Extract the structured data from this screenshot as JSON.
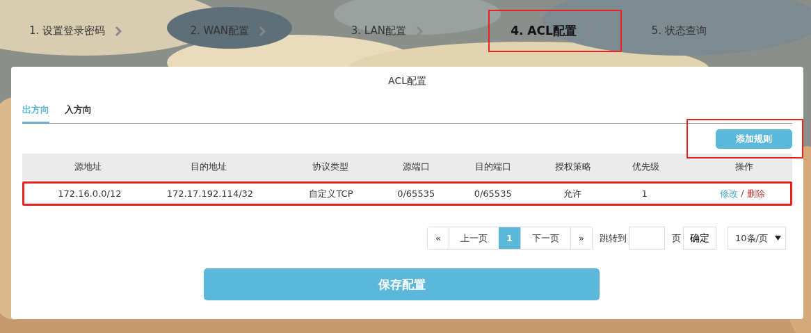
{
  "steps": [
    {
      "label": "1. 设置登录密码",
      "selected": false,
      "highlighted": false
    },
    {
      "label": "2. WAN配置",
      "selected": false,
      "highlighted": false
    },
    {
      "label": "3. LAN配置",
      "selected": false,
      "highlighted": false
    },
    {
      "label": "4. ACL配置",
      "selected": true,
      "highlighted": true
    },
    {
      "label": "5. 状态查询",
      "selected": false,
      "highlighted": false
    }
  ],
  "panel": {
    "title": "ACL配置",
    "tabs": [
      {
        "label": "出方向",
        "selected": true
      },
      {
        "label": "入方向",
        "selected": false
      }
    ],
    "add_button": {
      "label": "添加规则",
      "highlighted": true
    },
    "table": {
      "columns": [
        "源地址",
        "目的地址",
        "协议类型",
        "源端口",
        "目的端口",
        "授权策略",
        "优先级",
        "操作"
      ],
      "rows": [
        {
          "highlighted": true,
          "cells": [
            "172.16.0.0/12",
            "172.17.192.114/32",
            "自定义TCP",
            "0/65535",
            "0/65535",
            "允许",
            "1"
          ],
          "edit": "修改",
          "separator": "/",
          "delete": "删除"
        }
      ]
    },
    "pagination": {
      "first": "«",
      "prev": "上一页",
      "pages": [
        {
          "label": "1",
          "selected": true
        }
      ],
      "next": "下一页",
      "last": "»",
      "jump_label": "跳转到",
      "page_unit": "页",
      "confirm": "确定",
      "page_size": "10条/页"
    },
    "save_button": "保存配置"
  }
}
